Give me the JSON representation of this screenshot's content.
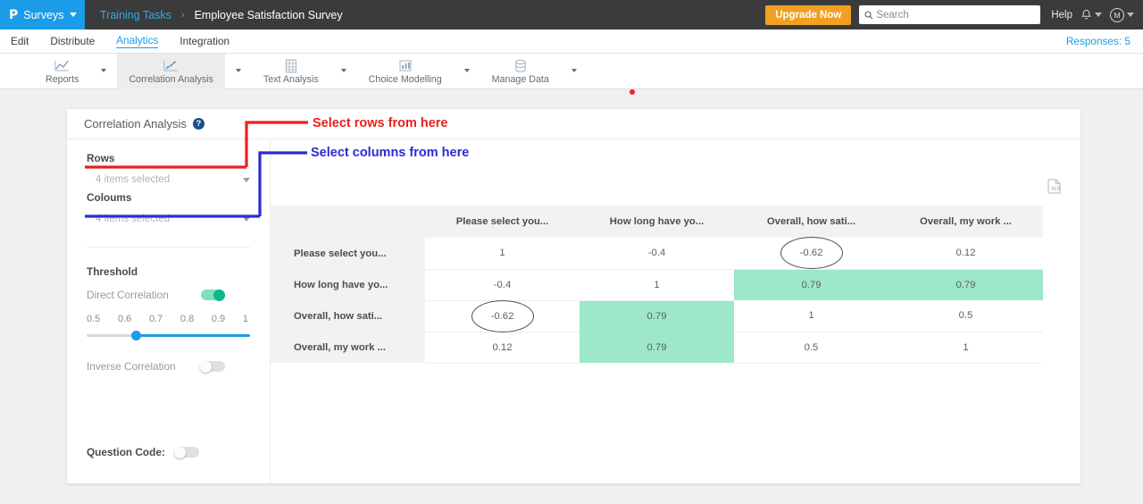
{
  "header": {
    "logo_label": "Surveys",
    "logo_mark": "P",
    "breadcrumb_parent": "Training Tasks",
    "breadcrumb_sep": "›",
    "breadcrumb_current": "Employee Satisfaction Survey",
    "upgrade_label": "Upgrade Now",
    "search_placeholder": "Search",
    "help_label": "Help",
    "avatar_initial": "M"
  },
  "tabs": {
    "items": [
      {
        "label": "Edit",
        "active": false
      },
      {
        "label": "Distribute",
        "active": false
      },
      {
        "label": "Analytics",
        "active": true
      },
      {
        "label": "Integration",
        "active": false
      }
    ],
    "responses_label": "Responses: 5"
  },
  "ribbon": {
    "items": [
      {
        "label": "Reports",
        "icon": "line-chart-icon",
        "active": false
      },
      {
        "label": "Correlation Analysis",
        "icon": "scatter-chart-icon",
        "active": true
      },
      {
        "label": "Text Analysis",
        "icon": "grid-table-icon",
        "active": false
      },
      {
        "label": "Choice Modelling",
        "icon": "bar-chart-icon",
        "active": false
      },
      {
        "label": "Manage Data",
        "icon": "database-icon",
        "active": false
      }
    ]
  },
  "panel": {
    "title": "Correlation Analysis",
    "help_glyph": "?",
    "rows_label": "Rows",
    "rows_value": "4 items selected",
    "columns_label": "Coloums",
    "columns_value": "4 items selected",
    "threshold_label": "Threshold",
    "direct_label": "Direct Correlation",
    "direct_on": true,
    "inverse_label": "Inverse Correlation",
    "inverse_on": false,
    "ticks": [
      "0.5",
      "0.6",
      "0.7",
      "0.8",
      "0.9",
      "1"
    ],
    "slider_value": "0.62",
    "question_code_label": "Question Code:",
    "question_code_on": false
  },
  "annotations": [
    {
      "text": "Select rows from here",
      "color": "#e8201f"
    },
    {
      "text": "Select columns from here",
      "color": "#2b2bd4"
    }
  ],
  "export": {
    "icon": "xls-export-icon"
  },
  "chart_data": {
    "type": "heatmap",
    "title": "Correlation Analysis",
    "categories": [
      "Please select you...",
      "How long have yo...",
      "Overall, how sati...",
      "Overall, my work ..."
    ],
    "row_labels": [
      "Please select you...",
      "How long have yo...",
      "Overall, how sati...",
      "Overall, my work ..."
    ],
    "column_labels": [
      "Please select you...",
      "How long have yo...",
      "Overall, how sati...",
      "Overall, my work ..."
    ],
    "values": [
      [
        1,
        -0.4,
        -0.62,
        0.12
      ],
      [
        -0.4,
        1,
        0.79,
        0.79
      ],
      [
        -0.62,
        0.79,
        1,
        0.5
      ],
      [
        0.12,
        0.79,
        0.5,
        1
      ]
    ],
    "display": [
      [
        "1",
        "-0.4",
        "-0.62",
        "0.12"
      ],
      [
        "-0.4",
        "1",
        "0.79",
        "0.79"
      ],
      [
        "-0.62",
        "0.79",
        "1",
        "0.5"
      ],
      [
        "0.12",
        "0.79",
        "0.5",
        "1"
      ]
    ],
    "highlighted_cells": [
      [
        1,
        2
      ],
      [
        1,
        3
      ],
      [
        2,
        1
      ],
      [
        3,
        1
      ]
    ],
    "circled_cells": [
      [
        0,
        2
      ],
      [
        2,
        0
      ]
    ],
    "highlight_color": "#9ce8c8",
    "threshold": 0.62,
    "legend": "cells at or above threshold shaded green"
  }
}
